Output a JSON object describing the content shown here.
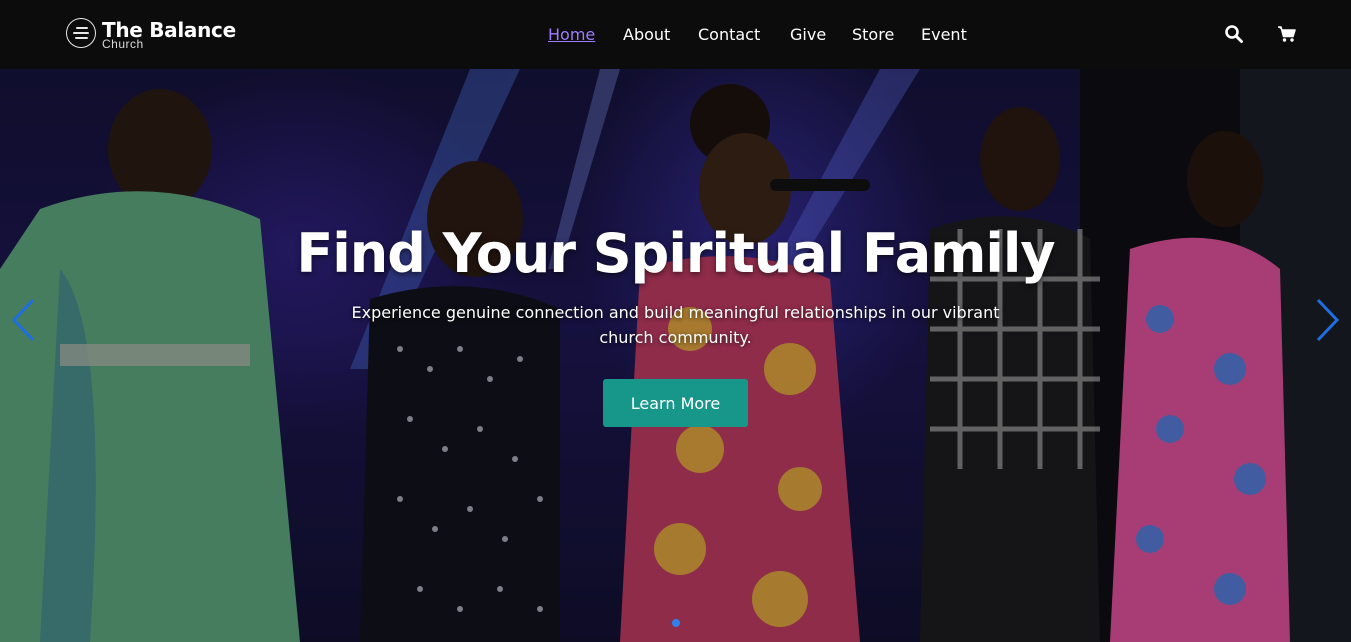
{
  "brand": {
    "name": "The Balance",
    "tagline": "Church"
  },
  "nav": {
    "items": [
      {
        "label": "Home",
        "active": true
      },
      {
        "label": "About",
        "active": false
      },
      {
        "label": "Contact",
        "active": false
      },
      {
        "label": "Give",
        "active": false
      },
      {
        "label": "Store",
        "active": false
      },
      {
        "label": "Event",
        "active": false
      }
    ]
  },
  "header_icons": [
    "search-icon",
    "cart-icon"
  ],
  "hero": {
    "title": "Find Your Spiritual Family",
    "subtitle": "Experience genuine connection and build meaningful relationships in our vibrant church community.",
    "cta_label": "Learn More",
    "slide_count": 1,
    "active_slide": 1
  },
  "colors": {
    "header_bg": "#0c0c0c",
    "nav_active": "#9f7cff",
    "cta_bg": "#17968a",
    "carousel_arrow": "#1e6fe0",
    "dot_active": "#2f80ed"
  }
}
